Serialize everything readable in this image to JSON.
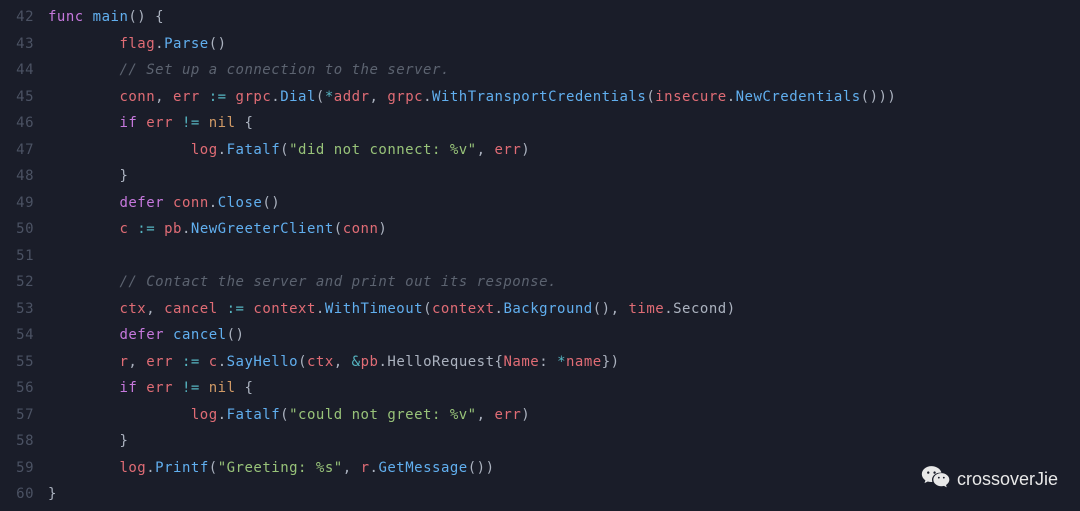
{
  "gutter": {
    "start": 42,
    "end": 60
  },
  "code": {
    "l42": {
      "kw_func": "func",
      "fn": "main",
      "rest": "() {"
    },
    "l43": {
      "obj": "flag",
      "dot": ".",
      "call": "Parse",
      "rest": "()"
    },
    "l44": {
      "comment": "// Set up a connection to the server."
    },
    "l45": {
      "v1": "conn",
      "c1": ", ",
      "v2": "err",
      "assign": " := ",
      "o1": "grpc",
      "d1": ".",
      "f1": "Dial",
      "p1": "(",
      "op1": "*",
      "a1": "addr",
      "c2": ", ",
      "o2": "grpc",
      "d2": ".",
      "f2": "WithTransportCredentials",
      "p2": "(",
      "o3": "insecure",
      "d3": ".",
      "f3": "NewCredentials",
      "p3": "()))"
    },
    "l46": {
      "kw_if": "if",
      "sp": " ",
      "v": "err",
      "op": " != ",
      "nil": "nil",
      "brace": " {"
    },
    "l47": {
      "obj": "log",
      "dot": ".",
      "fn": "Fatalf",
      "p1": "(",
      "str": "\"did not connect: %v\"",
      "c": ", ",
      "arg": "err",
      "p2": ")"
    },
    "l48": {
      "brace": "}"
    },
    "l49": {
      "kw": "defer",
      "sp": " ",
      "obj": "conn",
      "dot": ".",
      "fn": "Close",
      "p": "()"
    },
    "l50": {
      "v": "c",
      "assign": " := ",
      "obj": "pb",
      "dot": ".",
      "fn": "NewGreeterClient",
      "p1": "(",
      "arg": "conn",
      "p2": ")"
    },
    "l52": {
      "comment": "// Contact the server and print out its response."
    },
    "l53": {
      "v1": "ctx",
      "c1": ", ",
      "v2": "cancel",
      "assign": " := ",
      "o1": "context",
      "d1": ".",
      "f1": "WithTimeout",
      "p1": "(",
      "o2": "context",
      "d2": ".",
      "f2": "Background",
      "p2": "(), ",
      "o3": "time",
      "d3": ".",
      "a3": "Second",
      "p3": ")"
    },
    "l54": {
      "kw": "defer",
      "sp": " ",
      "fn": "cancel",
      "p": "()"
    },
    "l55": {
      "v1": "r",
      "c1": ", ",
      "v2": "err",
      "assign": " := ",
      "obj": "c",
      "dot": ".",
      "fn": "SayHello",
      "p1": "(",
      "a1": "ctx",
      "c2": ", ",
      "amp": "&",
      "o2": "pb",
      "d2": ".",
      "t": "HelloRequest",
      "b1": "{",
      "field": "Name",
      "colon": ": ",
      "op": "*",
      "a2": "name",
      "b2": "})"
    },
    "l56": {
      "kw_if": "if",
      "sp": " ",
      "v": "err",
      "op": " != ",
      "nil": "nil",
      "brace": " {"
    },
    "l57": {
      "obj": "log",
      "dot": ".",
      "fn": "Fatalf",
      "p1": "(",
      "str": "\"could not greet: %v\"",
      "c": ", ",
      "arg": "err",
      "p2": ")"
    },
    "l58": {
      "brace": "}"
    },
    "l59": {
      "obj": "log",
      "dot": ".",
      "fn": "Printf",
      "p1": "(",
      "str": "\"Greeting: %s\"",
      "c": ", ",
      "o2": "r",
      "d2": ".",
      "f2": "GetMessage",
      "p2": "())"
    },
    "l60": {
      "brace": "}"
    }
  },
  "watermark": {
    "text": "crossoverJie"
  }
}
